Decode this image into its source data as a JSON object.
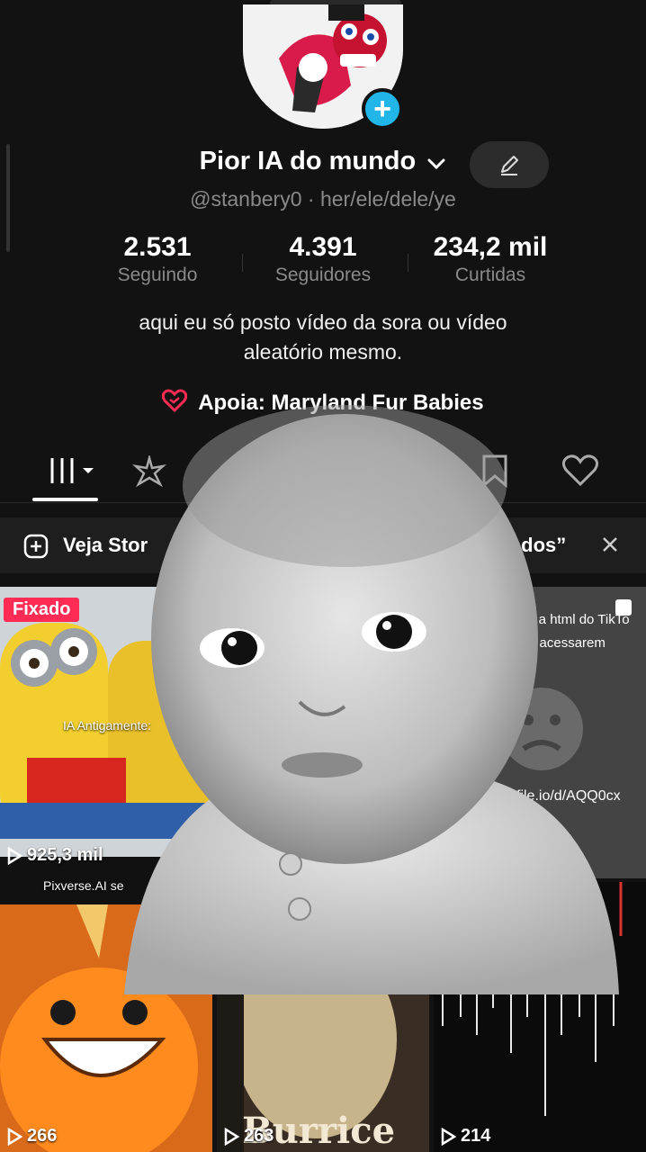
{
  "profile": {
    "display_name": "Pior IA do mundo",
    "handle": "@stanbery0 · her/ele/dele/ye",
    "stats": [
      {
        "value": "2.531",
        "label": "Seguindo"
      },
      {
        "value": "4.391",
        "label": "Seguidores"
      },
      {
        "value": "234,2 mil",
        "label": "Curtidas"
      }
    ],
    "bio_line1": "aqui eu só posto vídeo da sora ou vídeo",
    "bio_line2": "aleatório mesmo.",
    "support_text": "Apoia: Maryland Fur Babies"
  },
  "banner": {
    "left_text": "Veja Stor",
    "right_text": "rivados”"
  },
  "grid": {
    "pinned_label": "Fixado",
    "v1_views": "925,3 mil",
    "v1_caption_top": "IA Antigamente:",
    "v1_caption_bottom": "Pixverse.AI se",
    "v3_text_line1": "aixar a html do TikTo",
    "v3_text_line2": "s pra acessarem",
    "v3_link": "file.io/d/AQQ0cx",
    "v4_views": "266",
    "v5_views": "263",
    "v5_title": "Burrice",
    "v6_views": "214"
  },
  "colors": {
    "background": "#121212",
    "accent_plus": "#22b5e8",
    "pinned": "#fe2c55",
    "support_heart": "#fe2c55"
  }
}
